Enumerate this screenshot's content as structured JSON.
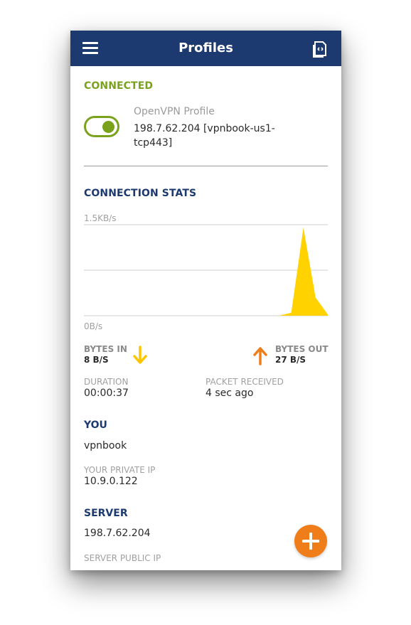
{
  "header": {
    "title": "Profiles",
    "menu_icon": "hamburger-menu-icon",
    "import_icon": "import-profile-icon"
  },
  "status": {
    "label": "CONNECTED",
    "toggle_on": true
  },
  "profile": {
    "name": "OpenVPN Profile",
    "server": "198.7.62.204 [vpnbook-us1-tcp443]"
  },
  "stats": {
    "label": "CONNECTION STATS",
    "chart_top_label": "1.5KB/s",
    "chart_bottom_label": "0B/s",
    "bytes_in_label": "BYTES IN",
    "bytes_in_value": "8 B/S",
    "bytes_out_label": "BYTES OUT",
    "bytes_out_value": "27 B/S",
    "duration_label": "DURATION",
    "duration_value": "00:00:37",
    "packet_label": "PACKET RECEIVED",
    "packet_value": "4 sec ago"
  },
  "chart_data": {
    "type": "area",
    "title": "",
    "xlabel": "",
    "ylabel": "",
    "ylim": [
      0,
      1.5
    ],
    "y_unit": "KB/s",
    "x": [
      0,
      1,
      2,
      3,
      4,
      5,
      6,
      7,
      8,
      9,
      10,
      11,
      12,
      13,
      14,
      15,
      16,
      17,
      18,
      19,
      20
    ],
    "values": [
      0,
      0,
      0,
      0,
      0,
      0,
      0,
      0,
      0,
      0,
      0,
      0,
      0,
      0,
      0,
      0,
      0,
      0.05,
      1.45,
      0.3,
      0.02
    ],
    "grid": true,
    "color": "#ffd200"
  },
  "you": {
    "label": "YOU",
    "username": "vpnbook",
    "private_ip_label": "YOUR PRIVATE IP",
    "private_ip": "10.9.0.122"
  },
  "server": {
    "label": "SERVER",
    "address": "198.7.62.204",
    "public_ip_label": "SERVER PUBLIC IP"
  },
  "colors": {
    "header_bg": "#1d3a70",
    "connected_green": "#7aa21d",
    "accent_orange": "#ef7d1a",
    "chart_yellow": "#ffd200"
  },
  "fab": {
    "icon": "plus-icon"
  }
}
